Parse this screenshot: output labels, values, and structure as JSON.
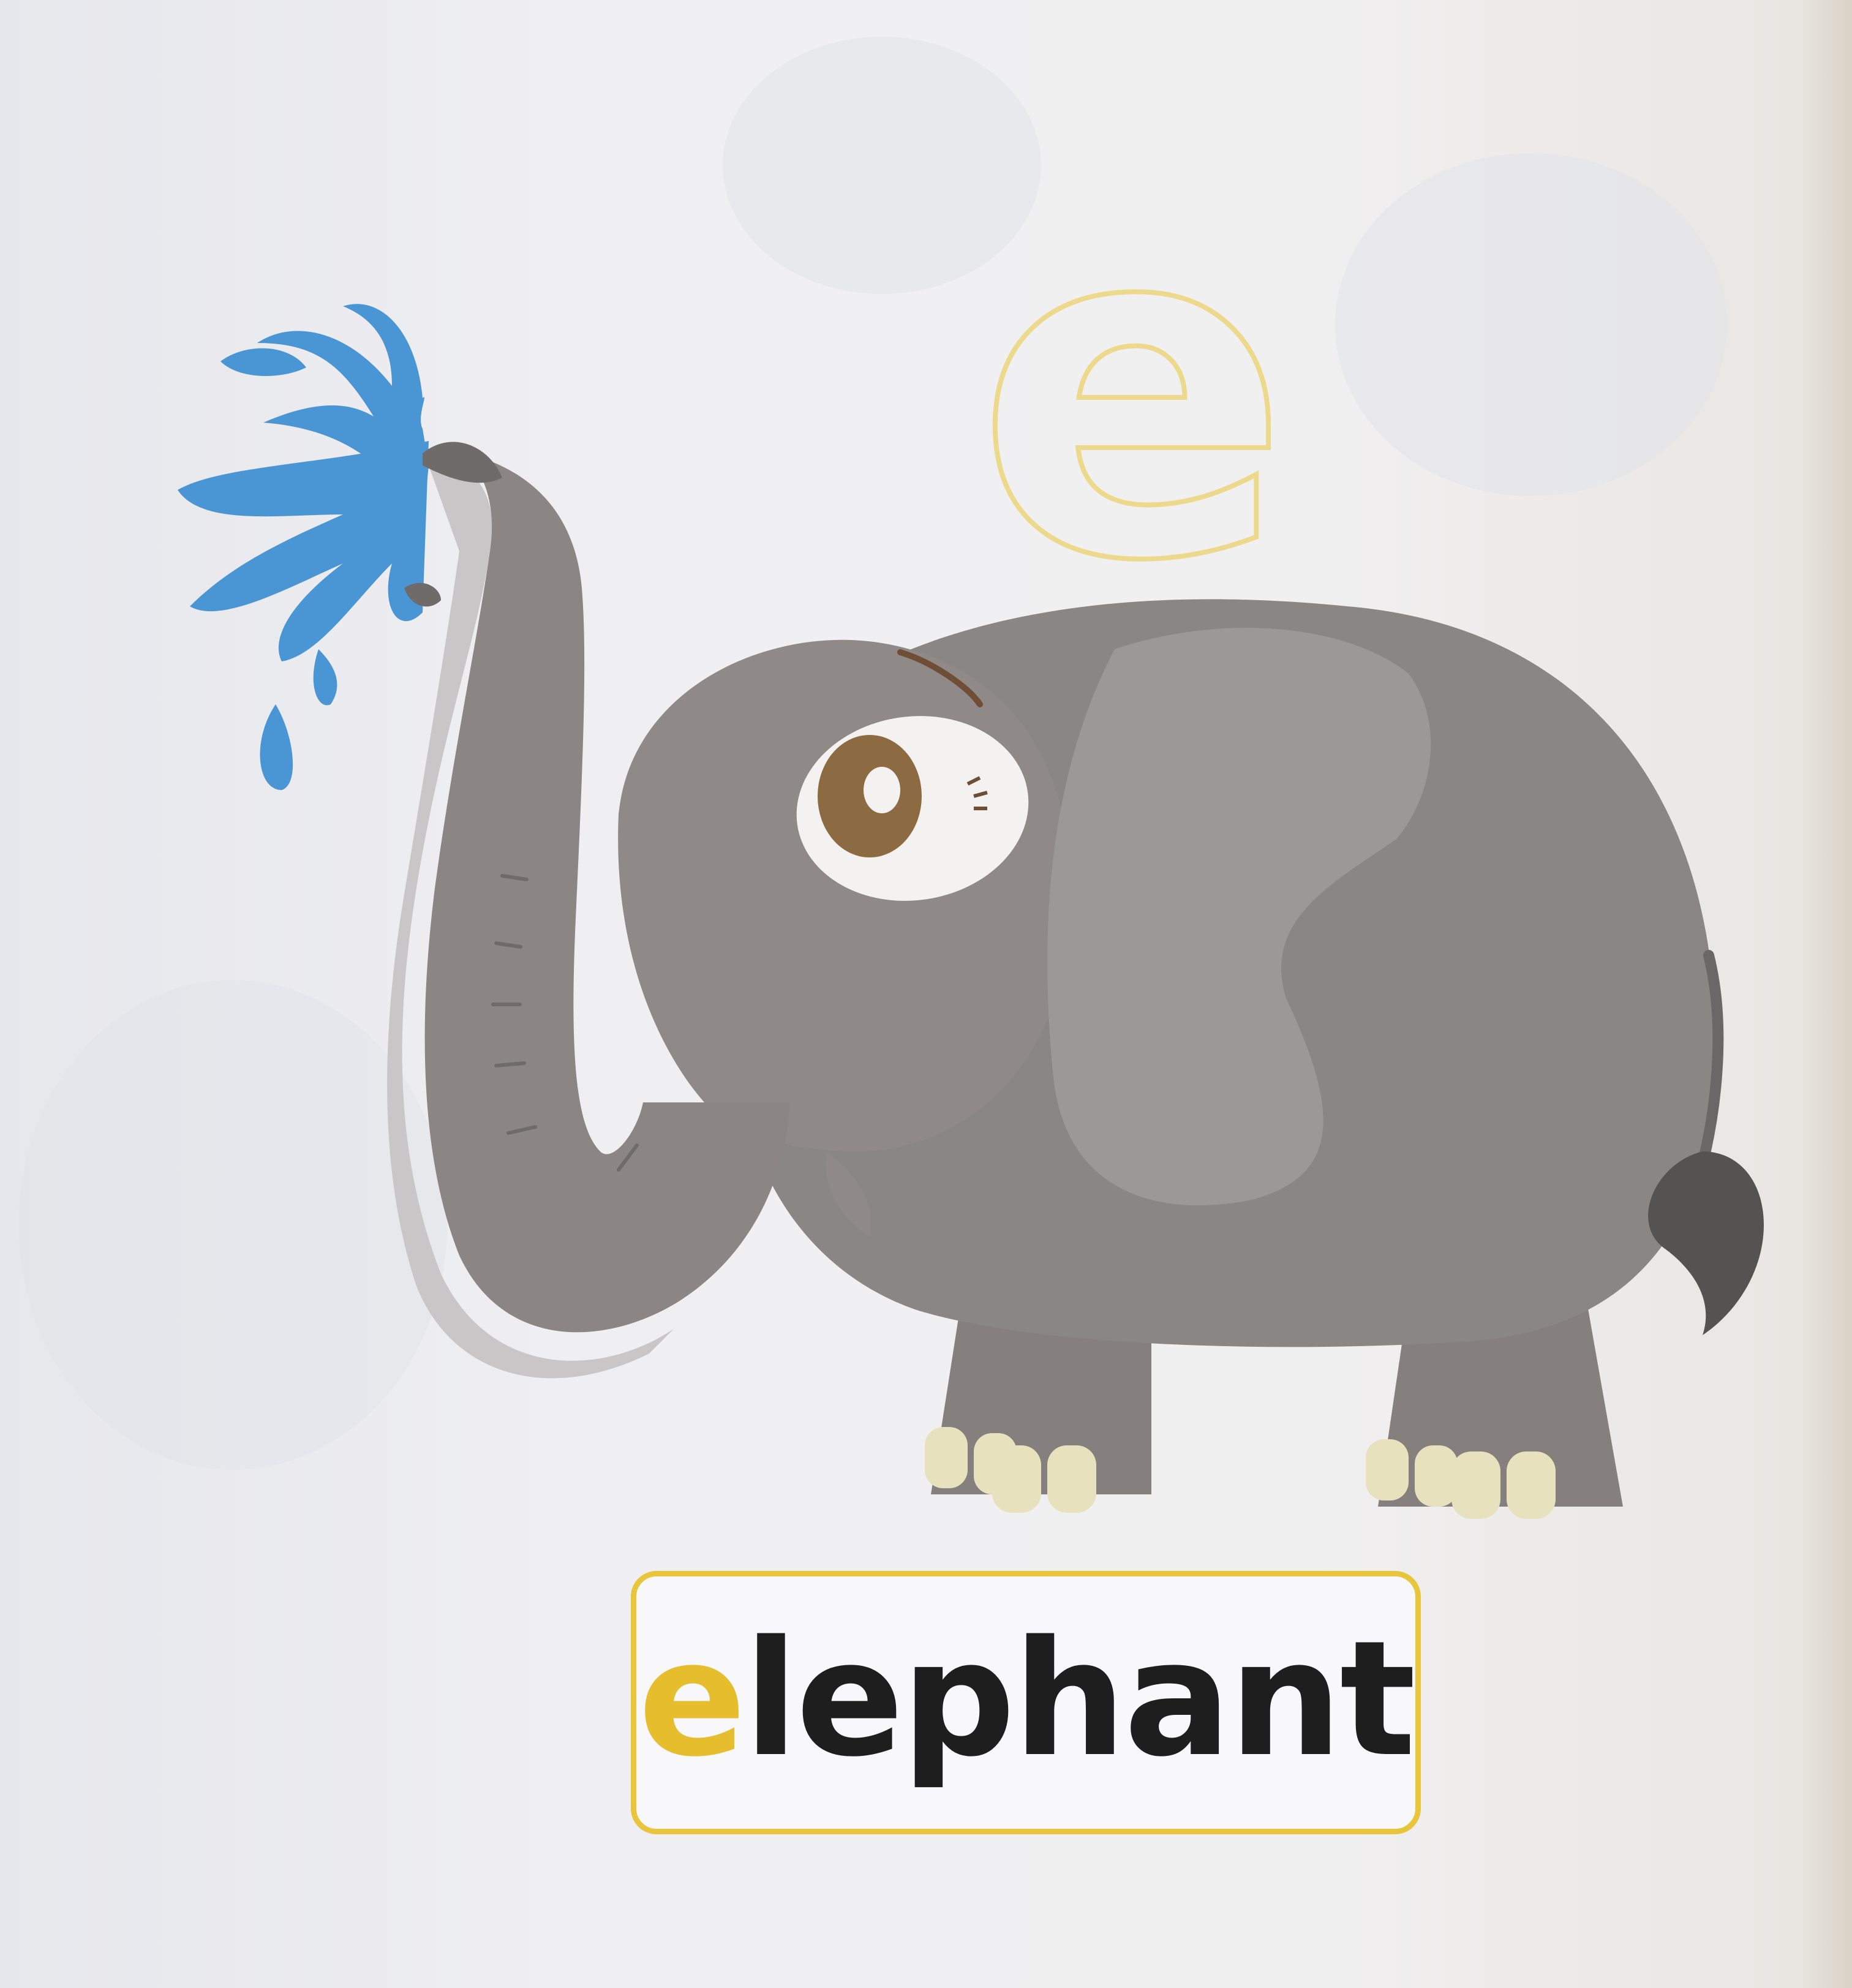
{
  "outline_letter": "e",
  "word": {
    "first_letter": "e",
    "rest": "lephant"
  },
  "colors": {
    "accent_yellow": "#e6bd2c",
    "water_blue": "#4a96d4",
    "elephant_gray": "#8a8684"
  }
}
